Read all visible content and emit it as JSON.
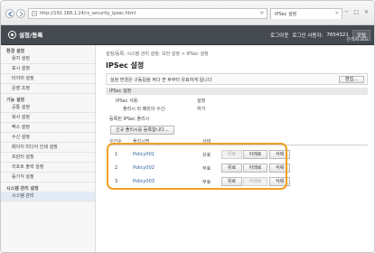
{
  "browser": {
    "address": "http://192.168.1.24/rs_security_ipsec.html",
    "tab_label": "IPSec 설정",
    "window_controls": "─ □ ✕"
  },
  "header": {
    "title": "설정/등록",
    "logout": "로그아웃",
    "user_label": "로그인 사용자:",
    "user_id": "7654321",
    "portal_button": "포털",
    "admin_mode": "관리자 모드"
  },
  "sidebar": {
    "sections": [
      {
        "header": "환경 설정",
        "items": [
          "용지 설정",
          "표시 설정",
          "타이머 설정",
          "운영 조정"
        ]
      },
      {
        "header": "기능 설정",
        "items": [
          "공통 설정",
          "복사 설정",
          "팩스 설정",
          "수신 설정",
          "페이지 미디어 인쇄 설정",
          "프린터 설정",
          "리포트 출력 설정",
          "동기식 설정"
        ]
      },
      {
        "header": "시스템 관리 설정",
        "items": [
          "시스템 관리"
        ]
      }
    ]
  },
  "main": {
    "breadcrumb": "설정/등록: 시스템 관리 설정: 보안 설정 > IPSec 설정",
    "title": "IPSec 설정",
    "notice": "설정 변경은 구동됩을 켜다 켠 후부터 유효하게 됩니다",
    "edit_button": "편집...",
    "section_label": "IPSec 설정",
    "ipsec_use_label": "IPSec 사용:",
    "ipsec_use_value": "설정",
    "receive_nonpolicy_label": "폴리시 외 패킷의 수신:",
    "receive_nonpolicy_value": "허가",
    "registered_label": "등록된 IPSec 폴리시",
    "register_button": "신규 폴리시를 등록합니다...",
    "columns": [
      "우선순",
      "폴리시명",
      "상태"
    ],
    "rows": [
      {
        "priority": "1",
        "name": "Policy001",
        "status": "유효"
      },
      {
        "priority": "2",
        "name": "Policy002",
        "status": "무효"
      },
      {
        "priority": "3",
        "name": "Policy003",
        "status": "무효"
      }
    ],
    "row_buttons": {
      "up": "위로",
      "down": "아래로",
      "delete": "삭제"
    }
  }
}
